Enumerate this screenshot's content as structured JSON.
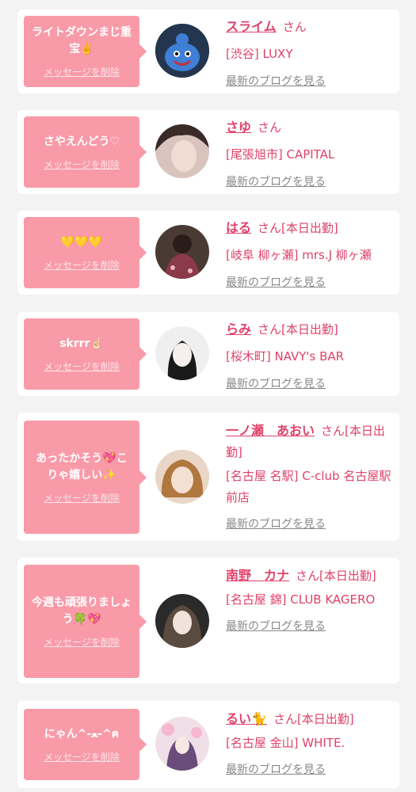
{
  "cards": [
    {
      "message": "ライトダウンまじ重宝✌️",
      "delete_label": "メッセージを削除",
      "name": "スライム",
      "san": "さん",
      "status": "",
      "shop": "[渋谷] LUXY",
      "blog_label": "最新のブログを見る"
    },
    {
      "message": "さやえんどう♡",
      "delete_label": "メッセージを削除",
      "name": "さゆ",
      "san": "さん",
      "status": "",
      "shop": "[尾張旭市] CAPITAL",
      "blog_label": "最新のブログを見る"
    },
    {
      "message": "💛💛💛",
      "delete_label": "メッセージを削除",
      "name": "はる",
      "san": "さん",
      "status": "[本日出勤]",
      "shop": "[岐阜 柳ヶ瀬] mrs.J 柳ヶ瀬",
      "blog_label": "最新のブログを見る"
    },
    {
      "message": "skrrr☝🏻",
      "delete_label": "メッセージを削除",
      "name": "らみ",
      "san": "さん",
      "status": "[本日出勤]",
      "shop": "[桜木町] NAVY's BAR",
      "blog_label": "最新のブログを見る"
    },
    {
      "message": "あったかそう💖こりゃ嬉しい✨",
      "delete_label": "メッセージを削除",
      "name": "一ノ瀬　あおい",
      "san": "さん",
      "status": "[本日出勤]",
      "shop": "[名古屋 名駅] C-club 名古屋駅前店",
      "blog_label": "最新のブログを見る"
    },
    {
      "message": "今週も頑張りましょう🍀💖",
      "delete_label": "メッセージを削除",
      "name": "南野　カナ",
      "san": "さん",
      "status": "[本日出勤]",
      "shop": "[名古屋 錦] CLUB KAGERO",
      "blog_label": "最新のブログを見る"
    },
    {
      "message": "にゃん^-ﻌ-^ฅ",
      "delete_label": "メッセージを削除",
      "name": "るい🐈",
      "san": "さん",
      "status": "[本日出勤]",
      "shop": "[名古屋 金山] WHITE.",
      "blog_label": "最新のブログを見る"
    }
  ],
  "colors": {
    "accent": "#e0416a",
    "bubble": "#f99aa8",
    "background": "#f3f3f3"
  }
}
